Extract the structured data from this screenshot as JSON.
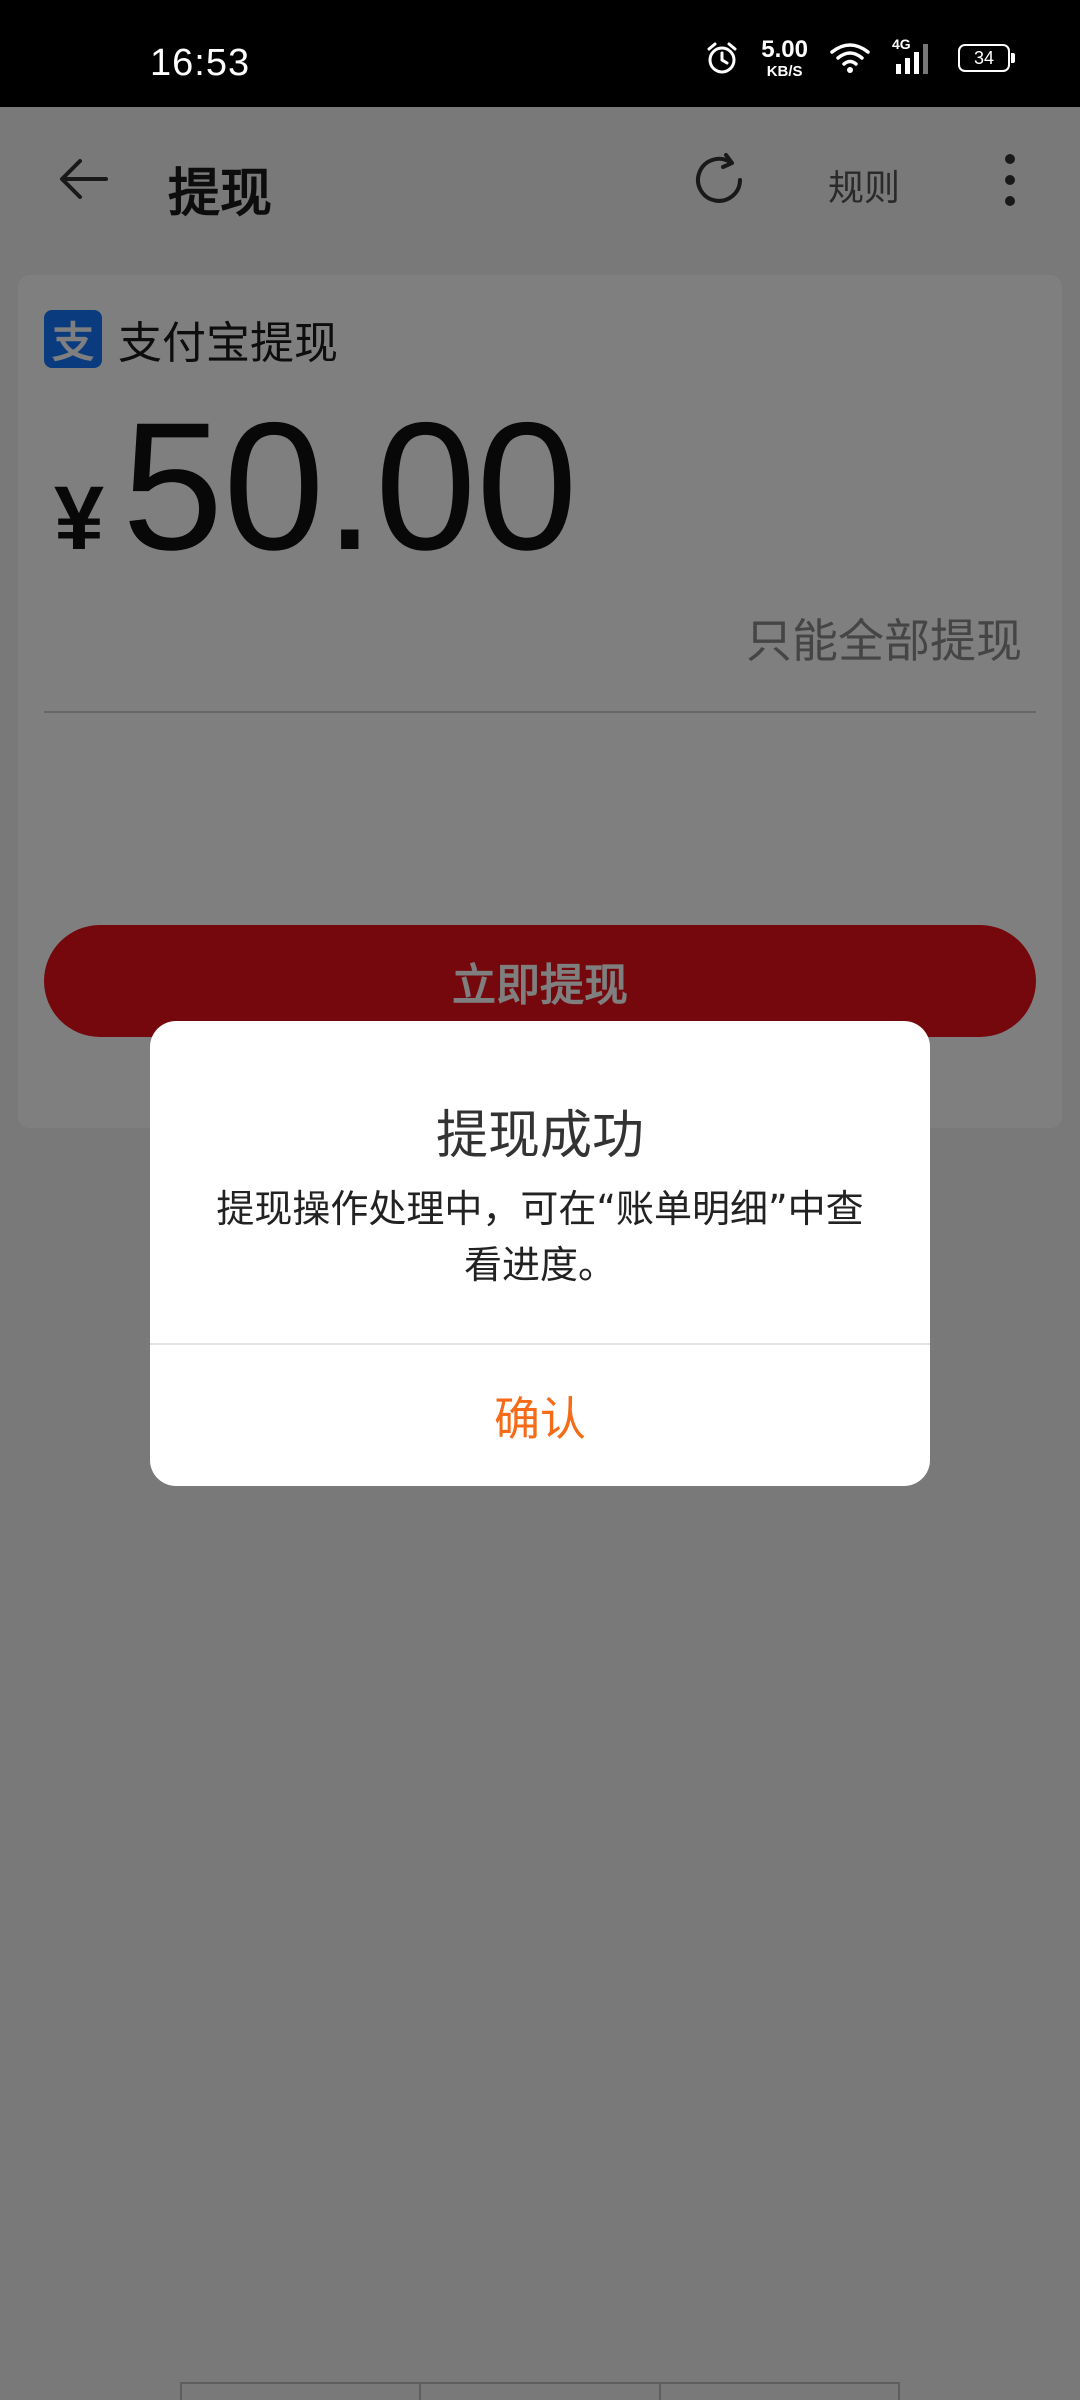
{
  "status_bar": {
    "time": "16:53",
    "net_speed_value": "5.00",
    "net_speed_unit": "KB/S",
    "network_type": "4G",
    "battery_level": "34",
    "icons": [
      "alarm-icon",
      "wifi-icon",
      "cellular-signal-icon",
      "battery-icon"
    ]
  },
  "app_bar": {
    "title": "提现",
    "rules_label": "规则",
    "icons": [
      "back-arrow-icon",
      "refresh-icon",
      "more-vertical-icon"
    ]
  },
  "withdraw_card": {
    "method_icon_glyph": "支",
    "method_label": "支付宝提现",
    "currency_symbol": "¥",
    "amount": "50.00",
    "full_withdraw_note": "只能全部提现",
    "submit_label": "立即提现"
  },
  "dialog": {
    "title": "提现成功",
    "message": "提现操作处理中，可在“账单明细”中查看进度。",
    "confirm_label": "确认"
  },
  "colors": {
    "status_bar_bg": "#000000",
    "page_bg": "#f3f3f3",
    "card_bg": "#ffffff",
    "submit_button_bg": "#e8101a",
    "alipay_blue": "#1677ff",
    "confirm_text": "#f56b18",
    "scrim": "rgba(0,0,0,0.5)"
  }
}
